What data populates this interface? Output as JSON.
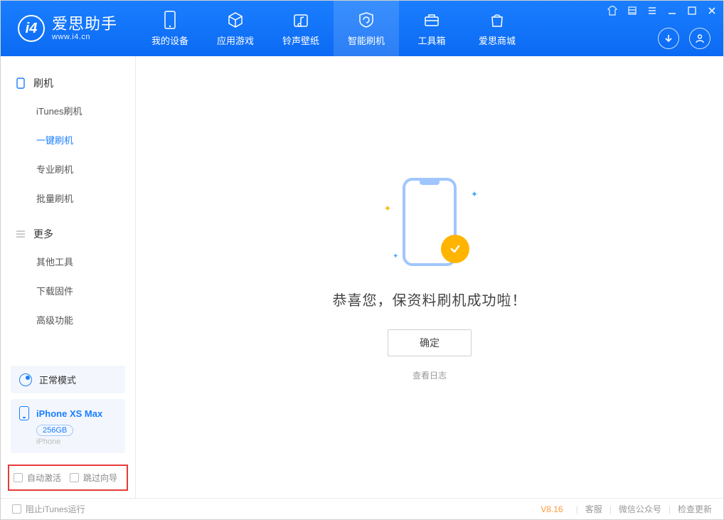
{
  "app": {
    "title": "爱思助手",
    "subtitle": "www.i4.cn"
  },
  "tabs": [
    {
      "label": "我的设备"
    },
    {
      "label": "应用游戏"
    },
    {
      "label": "铃声壁纸"
    },
    {
      "label": "智能刷机"
    },
    {
      "label": "工具箱"
    },
    {
      "label": "爱思商城"
    }
  ],
  "sidebar": {
    "group1": {
      "title": "刷机",
      "items": [
        "iTunes刷机",
        "一键刷机",
        "专业刷机",
        "批量刷机"
      ]
    },
    "group2": {
      "title": "更多",
      "items": [
        "其他工具",
        "下载固件",
        "高级功能"
      ]
    }
  },
  "mode": {
    "label": "正常模式"
  },
  "device": {
    "name": "iPhone XS Max",
    "capacity": "256GB",
    "type": "iPhone"
  },
  "bottom_opts": {
    "auto_activate": "自动激活",
    "skip_wizard": "跳过向导"
  },
  "main": {
    "success": "恭喜您，保资料刷机成功啦！",
    "ok": "确定",
    "view_log": "查看日志"
  },
  "footer": {
    "block_itunes": "阻止iTunes运行",
    "version": "V8.16",
    "links": [
      "客服",
      "微信公众号",
      "检查更新"
    ]
  }
}
